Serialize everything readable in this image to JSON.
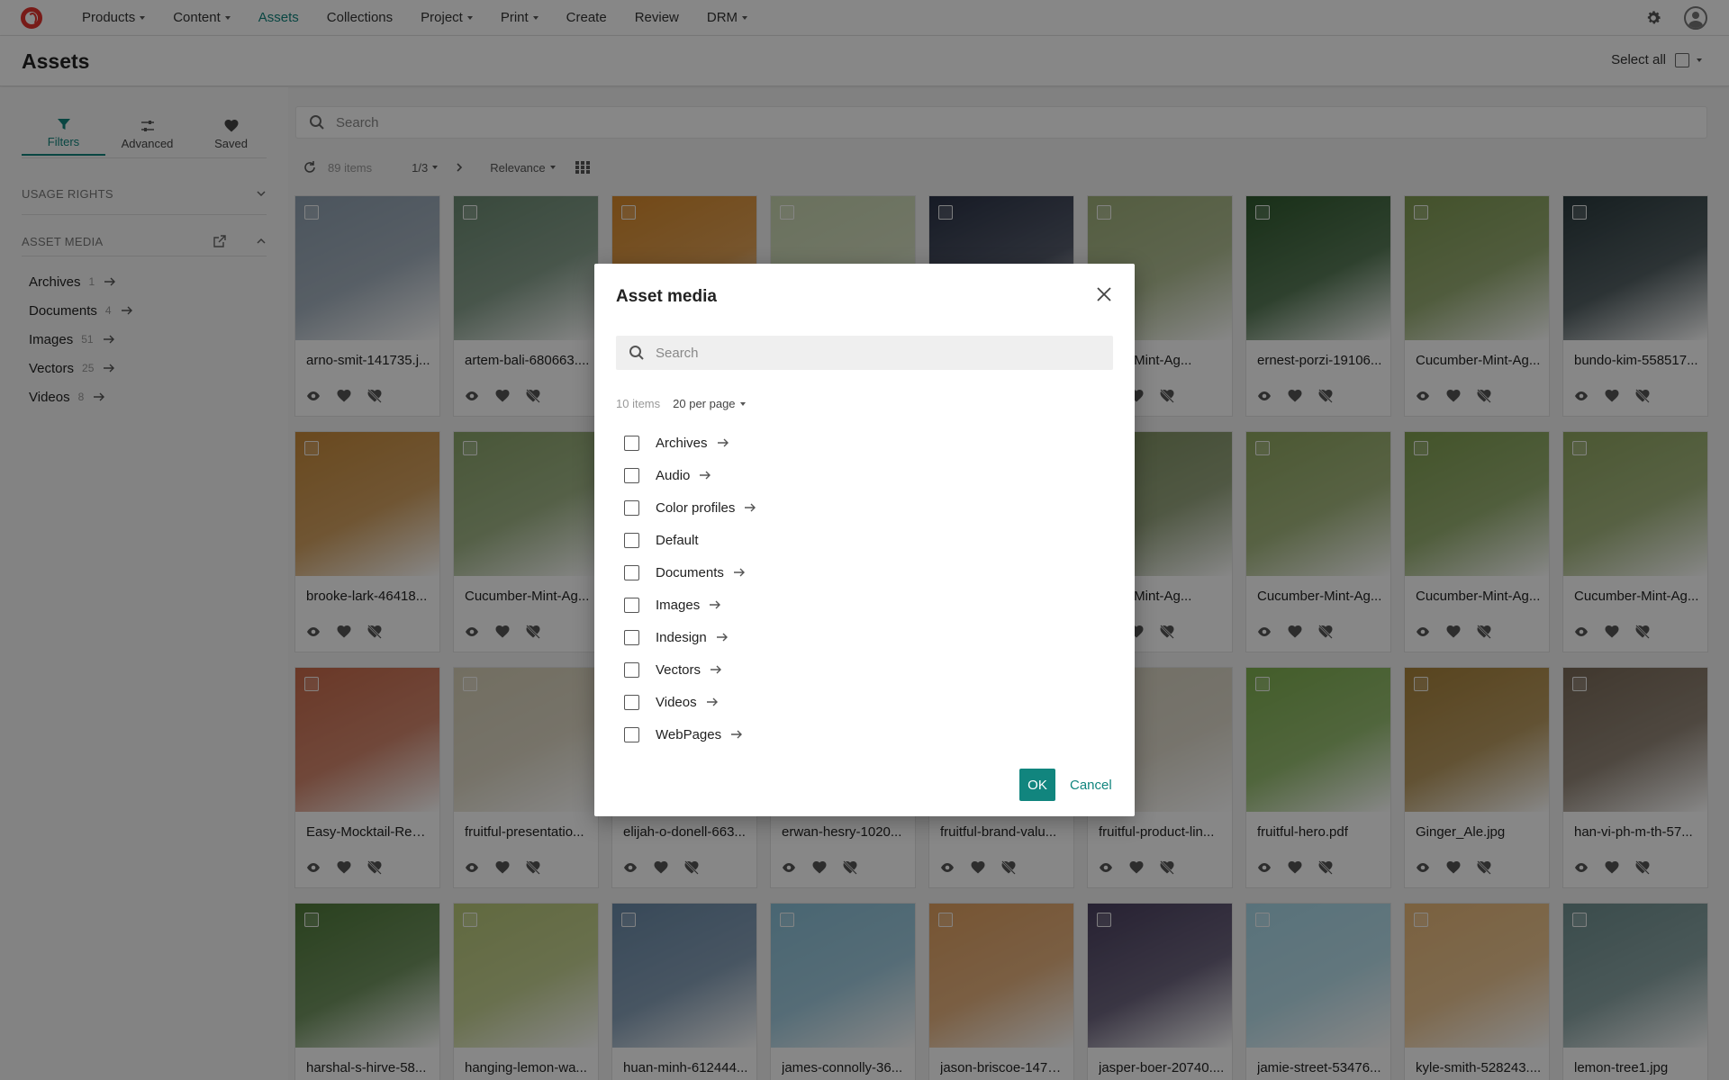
{
  "nav": {
    "items": [
      {
        "label": "Products",
        "dropdown": true
      },
      {
        "label": "Content",
        "dropdown": true
      },
      {
        "label": "Assets",
        "dropdown": false,
        "active": true
      },
      {
        "label": "Collections",
        "dropdown": false
      },
      {
        "label": "Project",
        "dropdown": true
      },
      {
        "label": "Print",
        "dropdown": true
      },
      {
        "label": "Create",
        "dropdown": false
      },
      {
        "label": "Review",
        "dropdown": false
      },
      {
        "label": "DRM",
        "dropdown": true
      }
    ],
    "icons": {
      "settings": "gear-icon",
      "user": "avatar-icon"
    }
  },
  "page": {
    "title": "Assets",
    "select_all_label": "Select all"
  },
  "sidebar": {
    "tabs": [
      {
        "label": "Filters",
        "icon": "filter-icon",
        "active": true
      },
      {
        "label": "Advanced",
        "icon": "sliders-icon"
      },
      {
        "label": "Saved",
        "icon": "heart-icon"
      }
    ],
    "sections": {
      "usage_rights": "USAGE RIGHTS",
      "asset_media": "ASSET MEDIA"
    },
    "media": [
      {
        "label": "Archives",
        "count": "1"
      },
      {
        "label": "Documents",
        "count": "4"
      },
      {
        "label": "Images",
        "count": "51"
      },
      {
        "label": "Vectors",
        "count": "25"
      },
      {
        "label": "Videos",
        "count": "8"
      }
    ]
  },
  "search": {
    "placeholder": "Search"
  },
  "toolbar": {
    "count": "89 items",
    "page": "1/3",
    "sort": "Relevance"
  },
  "assets": [
    "arno-smit-141735.j...",
    "artem-bali-680663....",
    "",
    "",
    "",
    "...ber-Mint-Ag...",
    "ernest-porzi-19106...",
    "Cucumber-Mint-Ag...",
    "bundo-kim-558517...",
    "brooke-lark-46418...",
    "Cucumber-Mint-Ag...",
    "",
    "",
    "",
    "...ber-Mint-Ag...",
    "Cucumber-Mint-Ag...",
    "Cucumber-Mint-Ag...",
    "Cucumber-Mint-Ag...",
    "Easy-Mocktail-Reci...",
    "fruitful-presentatio...",
    "elijah-o-donell-663...",
    "erwan-hesry-1020...",
    "fruitful-brand-valu...",
    "fruitful-product-lin...",
    "fruitful-hero.pdf",
    "Ginger_Ale.jpg",
    "han-vi-ph-m-th-57...",
    "harshal-s-hirve-58...",
    "hanging-lemon-wa...",
    "huan-minh-612444...",
    "james-connolly-36...",
    "jason-briscoe-1472...",
    "jasper-boer-20740....",
    "jamie-street-53476...",
    "kyle-smith-528243....",
    "lemon-tree1.jpg"
  ],
  "colors": {
    "accent": "#11857e",
    "thumbs": [
      "#8fa0b0",
      "#6b8a72",
      "#d98a2b",
      "#c9d6b0",
      "#2b3347",
      "#9fb07a",
      "#2f5a2e",
      "#7f9a52",
      "#2a3a3e",
      "#c88a3a",
      "#8aa46a",
      "#88a070",
      "#9aa888",
      "#8b9a7a",
      "#7e9060",
      "#8fa760",
      "#7f9e50",
      "#8fa660",
      "#c96a4a",
      "#d8d0b8",
      "#6f8a90",
      "#8ea0a8",
      "#6a8a50",
      "#d8d2c0",
      "#7fb050",
      "#a8823a",
      "#7a6a58",
      "#4f7a3a",
      "#b8c878",
      "#6a8aa8",
      "#8ac0d8",
      "#e0a060",
      "#4a4060",
      "#a8d8e8",
      "#e8b878",
      "#6f9090"
    ]
  },
  "dialog": {
    "title": "Asset media",
    "search_placeholder": "Search",
    "count": "10 items",
    "per_page": "20 per page",
    "items": [
      {
        "label": "Archives",
        "arrow": true
      },
      {
        "label": "Audio",
        "arrow": true
      },
      {
        "label": "Color profiles",
        "arrow": true
      },
      {
        "label": "Default",
        "arrow": false
      },
      {
        "label": "Documents",
        "arrow": true
      },
      {
        "label": "Images",
        "arrow": true
      },
      {
        "label": "Indesign",
        "arrow": true
      },
      {
        "label": "Vectors",
        "arrow": true
      },
      {
        "label": "Videos",
        "arrow": true
      },
      {
        "label": "WebPages",
        "arrow": true
      }
    ],
    "ok_label": "OK",
    "cancel_label": "Cancel"
  }
}
